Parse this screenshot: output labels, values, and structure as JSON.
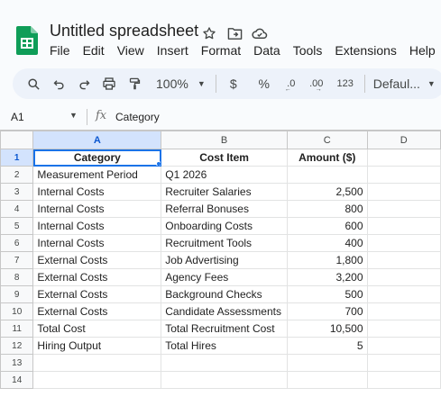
{
  "document": {
    "title": "Untitled spreadsheet"
  },
  "menu": [
    "File",
    "Edit",
    "View",
    "Insert",
    "Format",
    "Data",
    "Tools",
    "Extensions",
    "Help"
  ],
  "toolbar": {
    "zoom": "100%",
    "currency": "$",
    "percent": "%",
    "decrease_decimals": ".0",
    "increase_decimals": ".00",
    "number_format": "123",
    "font": "Defaul..."
  },
  "formula_bar": {
    "cell_ref": "A1",
    "fx": "fx",
    "content": "Category"
  },
  "grid": {
    "columns": [
      "A",
      "B",
      "C",
      "D"
    ],
    "rows": [
      {
        "num": "1",
        "a": "Category",
        "b": "Cost Item",
        "c": "Amount ($)"
      },
      {
        "num": "2",
        "a": "Measurement Period",
        "b": "Q1 2026",
        "c": ""
      },
      {
        "num": "3",
        "a": "Internal Costs",
        "b": "Recruiter Salaries",
        "c": "2,500"
      },
      {
        "num": "4",
        "a": "Internal Costs",
        "b": "Referral Bonuses",
        "c": "800"
      },
      {
        "num": "5",
        "a": "Internal Costs",
        "b": "Onboarding Costs",
        "c": "600"
      },
      {
        "num": "6",
        "a": "Internal Costs",
        "b": "Recruitment Tools",
        "c": "400"
      },
      {
        "num": "7",
        "a": "External Costs",
        "b": "Job Advertising",
        "c": "1,800"
      },
      {
        "num": "8",
        "a": "External Costs",
        "b": "Agency Fees",
        "c": "3,200"
      },
      {
        "num": "9",
        "a": "External Costs",
        "b": "Background Checks",
        "c": "500"
      },
      {
        "num": "10",
        "a": "External Costs",
        "b": "Candidate Assessments",
        "c": "700"
      },
      {
        "num": "11",
        "a": "Total Cost",
        "b": "Total Recruitment Cost",
        "c": "10,500"
      },
      {
        "num": "12",
        "a": "Hiring Output",
        "b": "Total Hires",
        "c": "5"
      },
      {
        "num": "13",
        "a": "",
        "b": "",
        "c": ""
      },
      {
        "num": "14",
        "a": "",
        "b": "",
        "c": ""
      }
    ]
  },
  "colors": {
    "accent": "#1a73e8",
    "header_active_bg": "#d3e3fd",
    "sheets_green": "#0f9d58"
  }
}
